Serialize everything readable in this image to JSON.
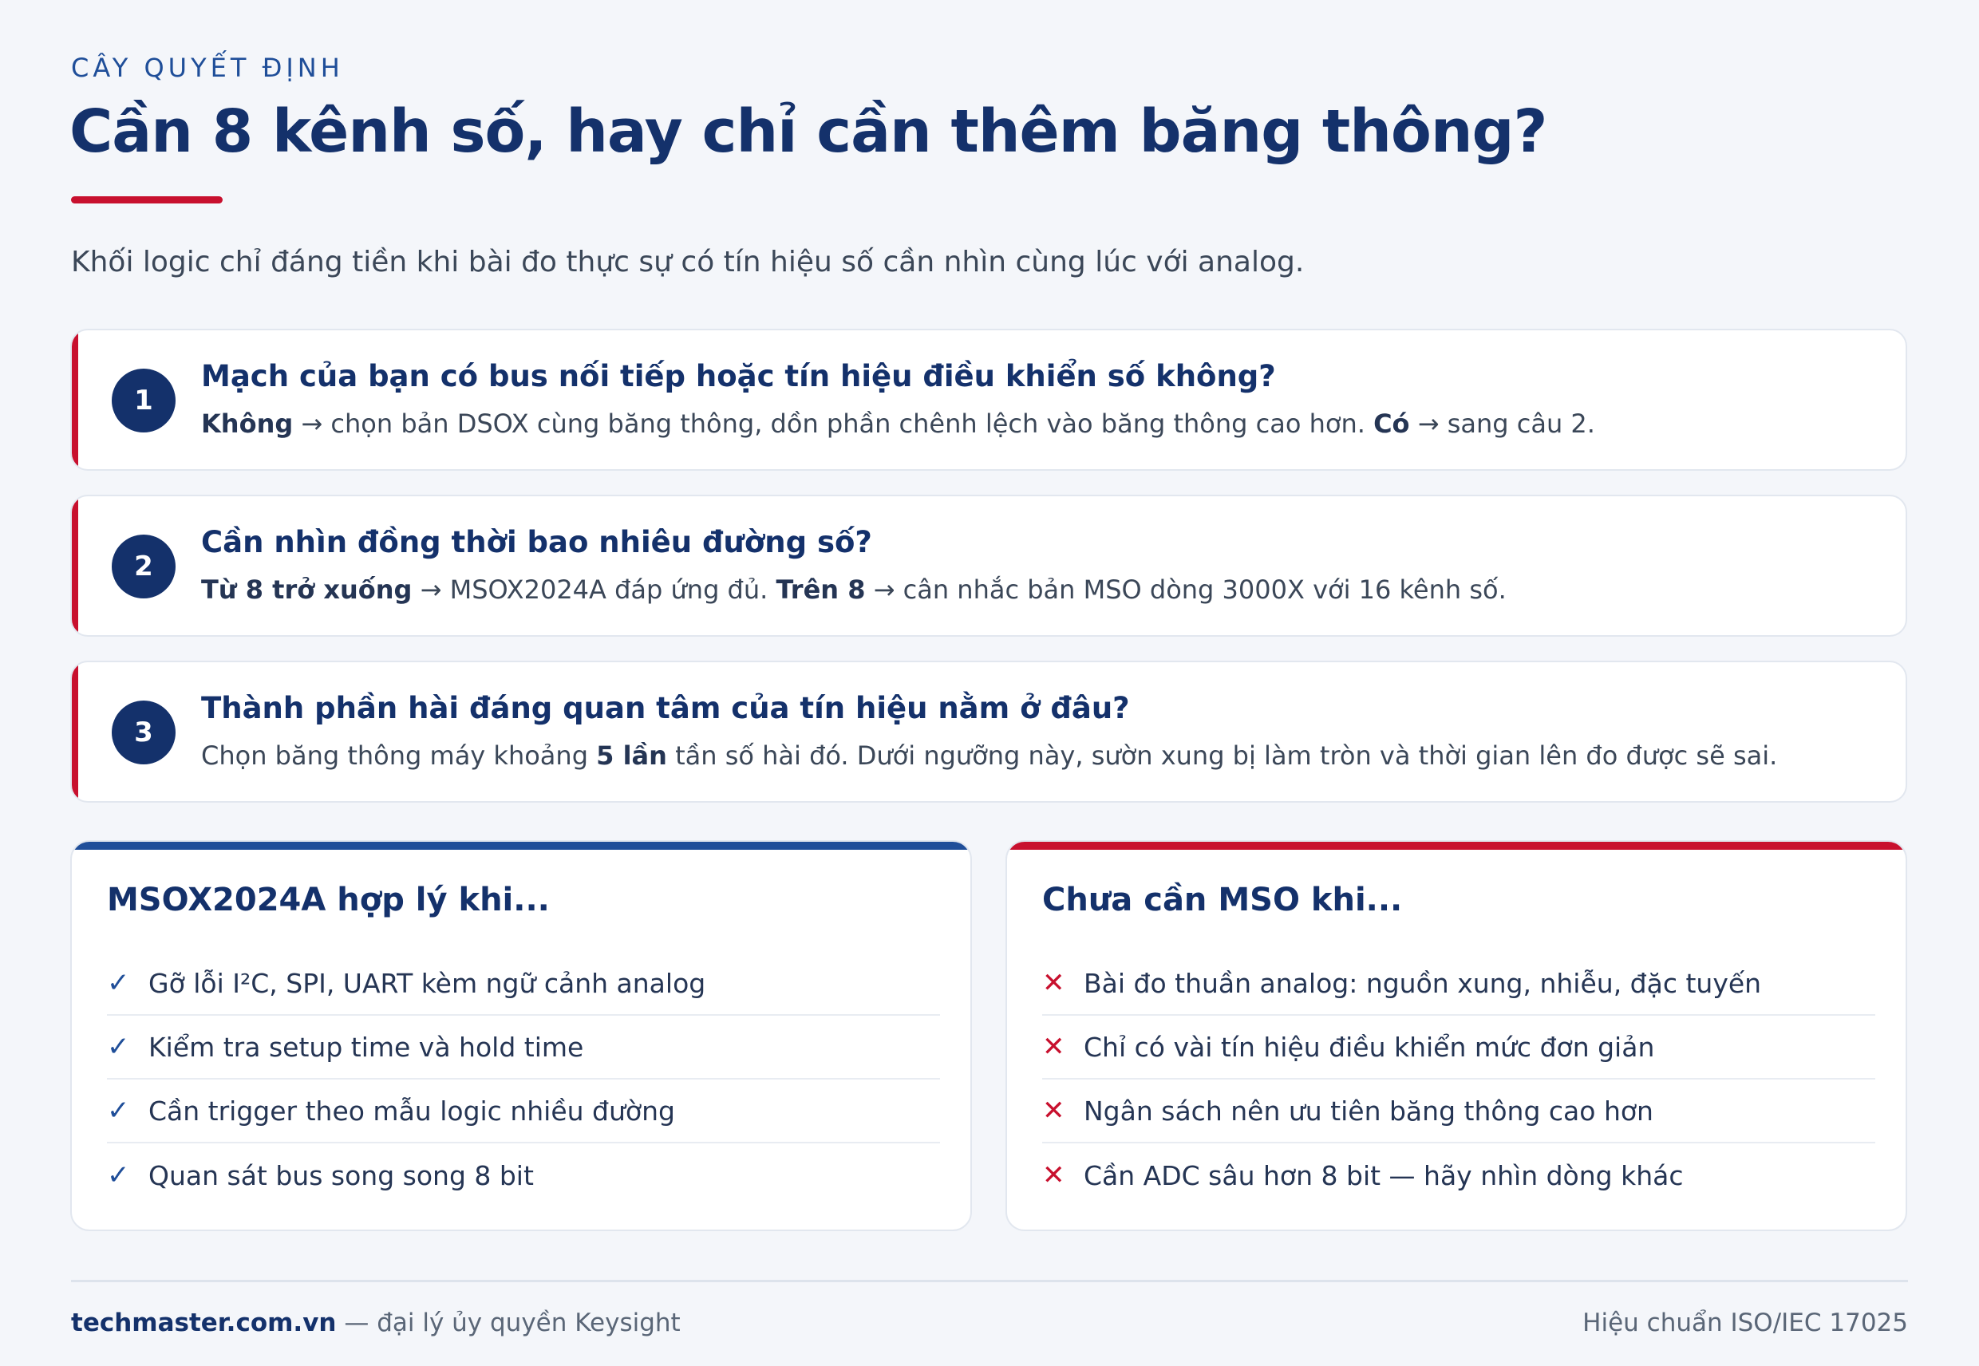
{
  "header": {
    "eyebrow": "CÂY QUYẾT ĐỊNH",
    "title": "Cần 8 kênh số, hay chỉ cần thêm băng thông?",
    "subtitle": "Khối logic chỉ đáng tiền khi bài đo thực sự có tín hiệu số cần nhìn cùng lúc với analog."
  },
  "steps": [
    {
      "number": "1",
      "question": "Mạch của bạn có bus nối tiếp hoặc tín hiệu điều khiển số không?",
      "answer_a_label": "Không",
      "answer_a_text": " → chọn bản DSOX cùng băng thông, dồn phần chênh lệch vào băng thông cao hơn.  ",
      "answer_b_label": "Có",
      "answer_b_text": " → sang câu 2."
    },
    {
      "number": "2",
      "question": "Cần nhìn đồng thời bao nhiêu đường số?",
      "answer_a_label": "Từ 8 trở xuống",
      "answer_a_text": " → MSOX2024A đáp ứng đủ.  ",
      "answer_b_label": "Trên 8",
      "answer_b_text": " → cân nhắc bản MSO dòng 3000X với 16 kênh số."
    },
    {
      "number": "3",
      "question": "Thành phần hài đáng quan tâm của tín hiệu nằm ở đâu?",
      "answer_pre": "Chọn băng thông máy khoảng ",
      "answer_bold": "5 lần",
      "answer_post": " tần số hài đó. Dưới ngưỡng này, sườn xung bị làm tròn và thời gian lên đo được sẽ sai."
    }
  ],
  "pro_card": {
    "title": "MSOX2024A hợp lý khi...",
    "mark": "✓",
    "items": [
      "Gỡ lỗi I²C, SPI, UART kèm ngữ cảnh analog",
      "Kiểm tra setup time và hold time",
      "Cần trigger theo mẫu logic nhiều đường",
      "Quan sát bus song song 8 bit"
    ]
  },
  "con_card": {
    "title": "Chưa cần MSO khi...",
    "mark": "✕",
    "items": [
      "Bài đo thuần analog: nguồn xung, nhiễu, đặc tuyến",
      "Chỉ có vài tín hiệu điều khiển mức đơn giản",
      "Ngân sách nên ưu tiên băng thông cao hơn",
      "Cần ADC sâu hơn 8 bit — hãy nhìn dòng khác"
    ]
  },
  "footer": {
    "brand": "techmaster.com.vn",
    "tagline": " — đại lý ủy quyền Keysight",
    "right": "Hiệu chuẩn ISO/IEC 17025"
  },
  "colors": {
    "navy": "#14316b",
    "accent_red": "#c8102e",
    "accent_blue": "#1f4e99",
    "background": "#f4f6fa"
  }
}
